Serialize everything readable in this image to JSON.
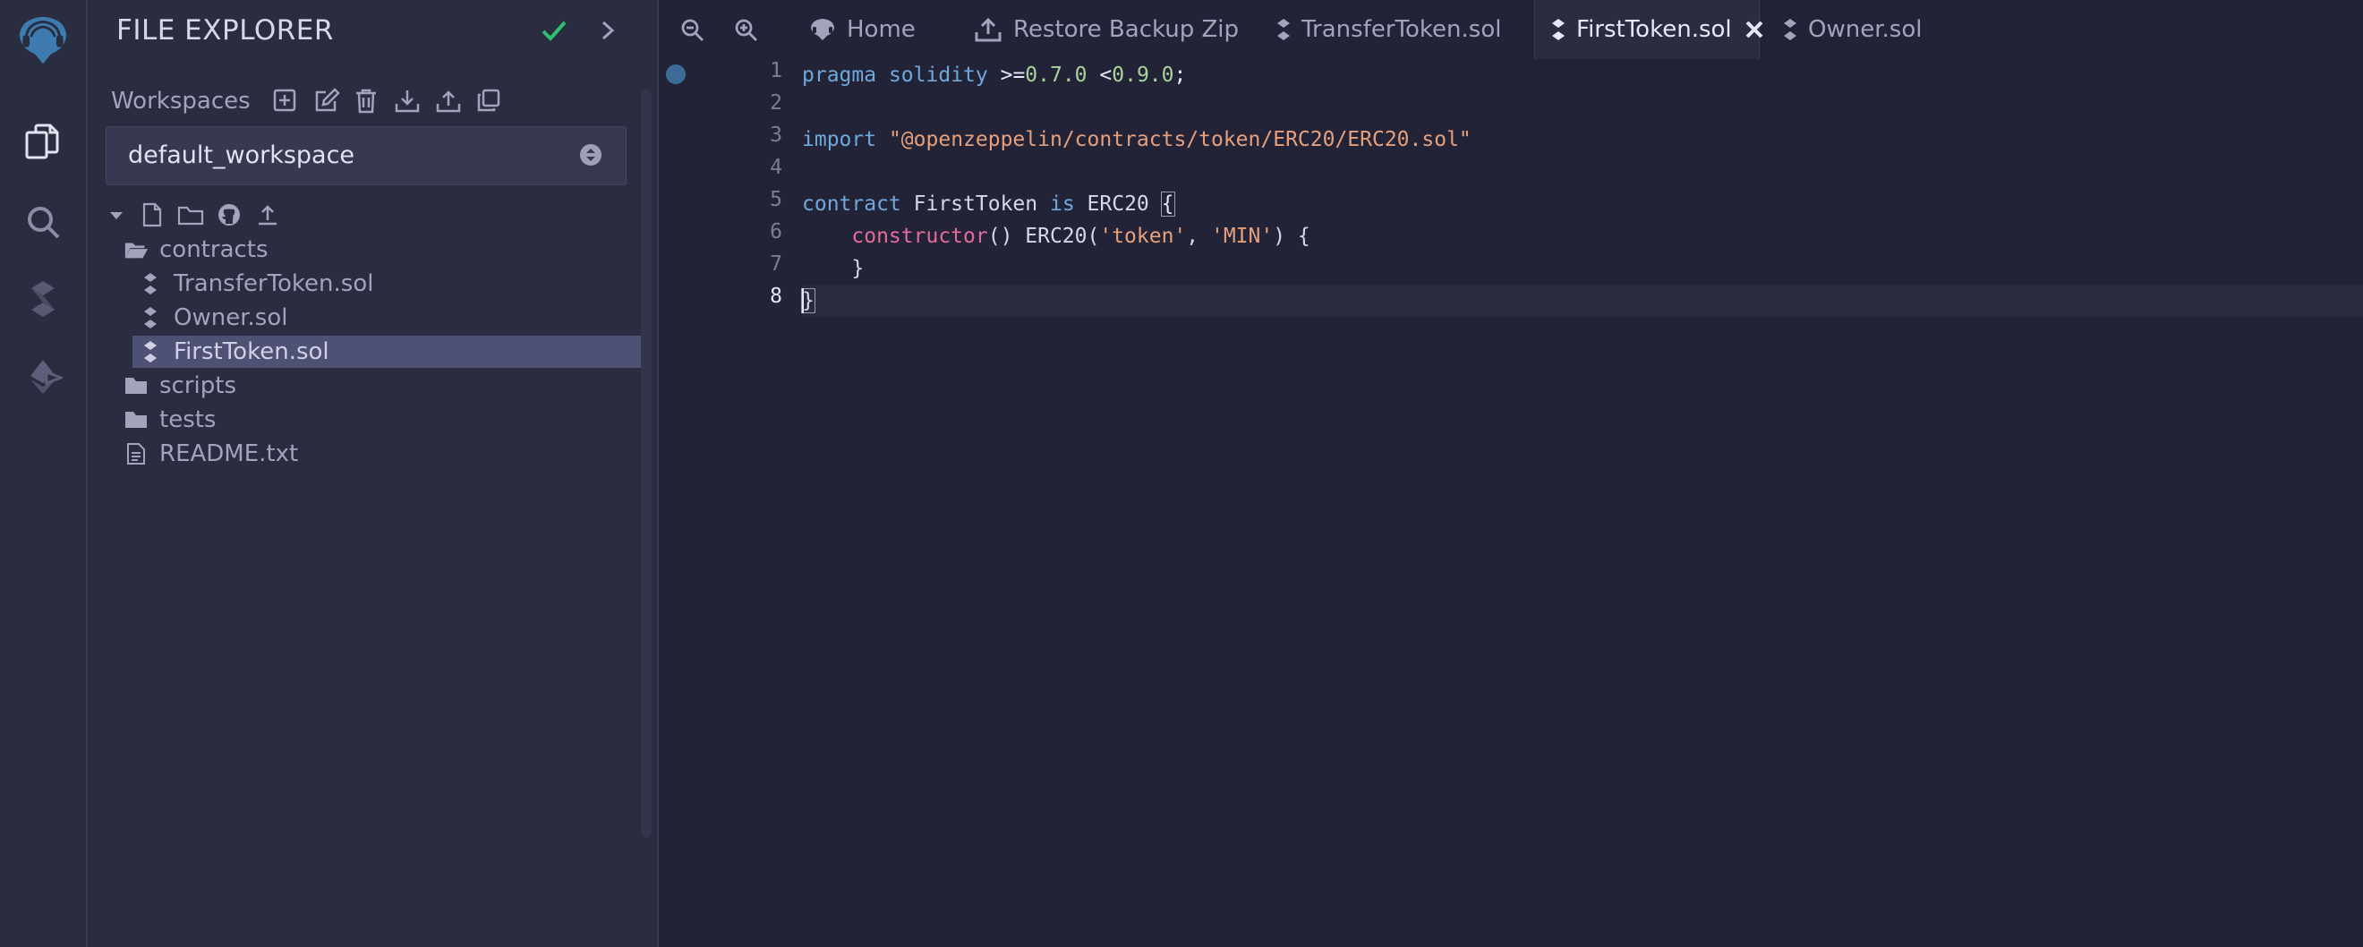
{
  "panel": {
    "title": "FILE EXPLORER",
    "workspaces_label": "Workspaces",
    "workspace_selected": "default_workspace"
  },
  "tree": {
    "items": [
      {
        "label": "contracts",
        "type": "folder-open"
      },
      {
        "label": "TransferToken.sol",
        "type": "sol"
      },
      {
        "label": "Owner.sol",
        "type": "sol"
      },
      {
        "label": "FirstToken.sol",
        "type": "sol",
        "selected": true
      },
      {
        "label": "scripts",
        "type": "folder"
      },
      {
        "label": "tests",
        "type": "folder"
      },
      {
        "label": "README.txt",
        "type": "file"
      }
    ]
  },
  "tabs": [
    {
      "label": "Home",
      "icon": "remix-logo-icon"
    },
    {
      "label": "Restore Backup Zip",
      "icon": "upload-icon"
    },
    {
      "label": "TransferToken.sol",
      "icon": "solidity-icon"
    },
    {
      "label": "FirstToken.sol",
      "icon": "solidity-icon",
      "active": true
    },
    {
      "label": "Owner.sol",
      "icon": "solidity-icon"
    }
  ],
  "editor": {
    "line_numbers": [
      "1",
      "2",
      "3",
      "4",
      "5",
      "6",
      "7",
      "8"
    ],
    "current_line": "8",
    "code": {
      "l1_kw1": "pragma",
      "l1_kw2": "solidity",
      "l1_op1": ">=",
      "l1_v1": "0.7.0",
      "l1_op2": "<",
      "l1_v2": "0.9.0",
      "l1_end": ";",
      "l3_kw": "import",
      "l3_str": "\"@openzeppelin/contracts/token/ERC20/ERC20.sol\"",
      "l5_kw1": "contract",
      "l5_name": "FirstToken",
      "l5_kw2": "is",
      "l5_base": "ERC20",
      "l5_brace": "{",
      "l6_indent": "    ",
      "l6_kw": "constructor",
      "l6_rest1": "() ERC20(",
      "l6_str1": "'token'",
      "l6_comma": ", ",
      "l6_str2": "'MIN'",
      "l6_rest2": ") {",
      "l7": "    }",
      "l8": "}"
    }
  },
  "colors": {
    "background": "#222336",
    "panel": "#2a2c3f",
    "accent": "#3d6b96",
    "keyword": "#6fa8dc",
    "string": "#e6a07c",
    "number": "#a8d39c",
    "check": "#2fbf71"
  }
}
